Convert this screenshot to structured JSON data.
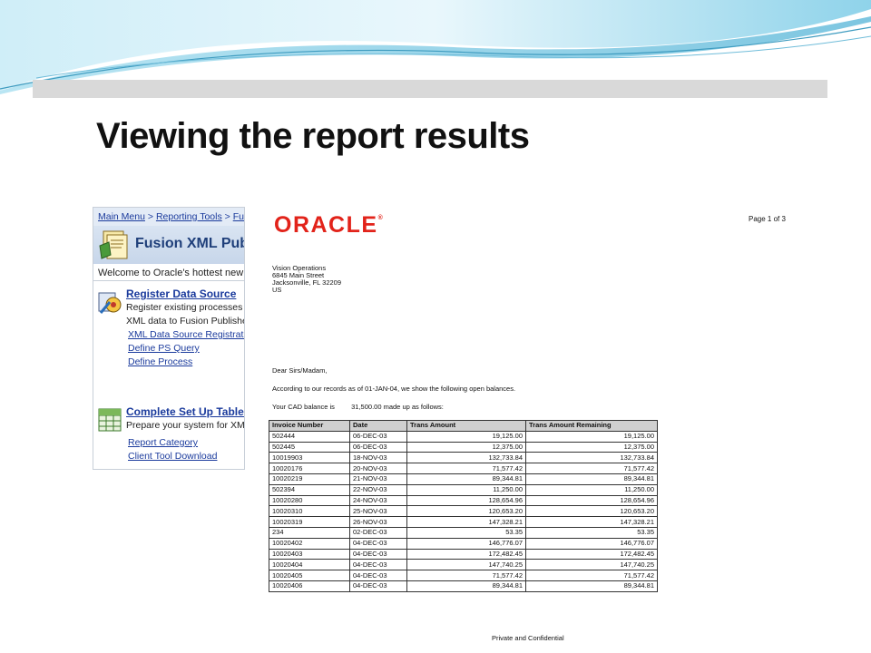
{
  "slide": {
    "title": "Viewing the report results"
  },
  "ps_page": {
    "breadcrumb": {
      "items": [
        "Main Menu",
        "Reporting Tools",
        "Fus"
      ],
      "separator": ">"
    },
    "header_title": "Fusion XML Pub",
    "welcome_text": "Welcome to Oracle's hottest new f",
    "register": {
      "title": "Register Data Source",
      "desc_line1": "Register existing processes",
      "desc_line2": "XML data to Fusion Publisher",
      "links": [
        "XML Data Source Registratio",
        "Define PS Query",
        "Define Process"
      ]
    },
    "setup": {
      "title": "Complete Set Up Tables",
      "desc_line1": "Prepare your system for XML",
      "links": [
        "Report Category",
        "Client Tool Download"
      ]
    }
  },
  "report": {
    "logo_text": "ORACLE",
    "logo_mark": "®",
    "page_label": "Page 1 of 3",
    "address": [
      "Vision Operations",
      "6845 Main Street",
      "Jacksonville, FL 32209",
      "US"
    ],
    "salutation": "Dear Sirs/Madam,",
    "intro": "According to our records as of 01-JAN-04, we show the following open balances.",
    "balance_label": "Your CAD balance is",
    "balance_value": "31,500.00",
    "balance_suffix": "made up as follows:",
    "footer": "Private and Confidential",
    "table": {
      "headers": [
        "Invoice Number",
        "Date",
        "Trans Amount",
        "Trans Amount Remaining"
      ],
      "rows": [
        [
          "502444",
          "06-DEC-03",
          "19,125.00",
          "19,125.00"
        ],
        [
          "502445",
          "06-DEC-03",
          "12,375.00",
          "12,375.00"
        ],
        [
          "10019903",
          "18-NOV-03",
          "132,733.84",
          "132,733.84"
        ],
        [
          "10020176",
          "20-NOV-03",
          "71,577.42",
          "71,577.42"
        ],
        [
          "10020219",
          "21-NOV-03",
          "89,344.81",
          "89,344.81"
        ],
        [
          "502394",
          "22-NOV-03",
          "11,250.00",
          "11,250.00"
        ],
        [
          "10020280",
          "24-NOV-03",
          "128,654.96",
          "128,654.96"
        ],
        [
          "10020310",
          "25-NOV-03",
          "120,653.20",
          "120,653.20"
        ],
        [
          "10020319",
          "26-NOV-03",
          "147,328.21",
          "147,328.21"
        ],
        [
          "234",
          "02-DEC-03",
          "53.35",
          "53.35"
        ],
        [
          "10020402",
          "04-DEC-03",
          "146,776.07",
          "146,776.07"
        ],
        [
          "10020403",
          "04-DEC-03",
          "172,482.45",
          "172,482.45"
        ],
        [
          "10020404",
          "04-DEC-03",
          "147,740.25",
          "147,740.25"
        ],
        [
          "10020405",
          "04-DEC-03",
          "71,577.42",
          "71,577.42"
        ],
        [
          "10020406",
          "04-DEC-03",
          "89,344.81",
          "89,344.81"
        ]
      ]
    }
  },
  "colors": {
    "oracle_red": "#e2231a",
    "link_blue": "#1a3a9c",
    "swoosh_blue": "#7ec8e3",
    "gray_bar": "#d9d9d9"
  },
  "icons": {
    "ps_header": "folder-reports-icon",
    "register": "gear-data-icon",
    "setup": "grid-table-icon"
  }
}
